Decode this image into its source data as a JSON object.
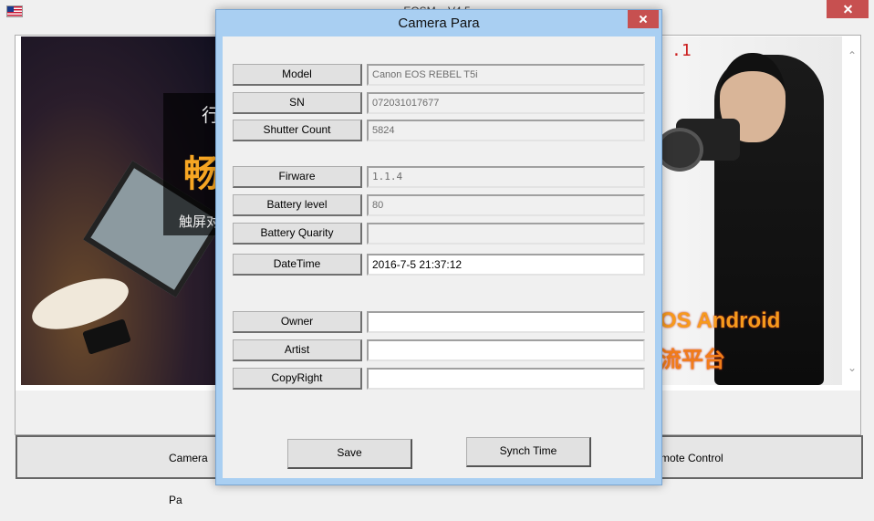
{
  "main": {
    "title": "EOSM... V4.5",
    "banner": {
      "overlay_hang": "行",
      "overlay_chang": "畅",
      "overlay_touch": "触屏对",
      "overlay_version": ".1",
      "overlay_android": "OS Android",
      "overlay_platform": "流平台"
    },
    "buttons": {
      "camera_para": "Camera Pa",
      "remote_control": "mote Control"
    }
  },
  "dialog": {
    "title": "Camera Para",
    "rows": [
      {
        "label": "Model",
        "value": "Canon EOS REBEL T5i",
        "editable": false
      },
      {
        "label": "SN",
        "value": "072031017677",
        "editable": false
      },
      {
        "label": "Shutter Count",
        "value": "5824",
        "editable": false
      },
      {
        "label": "Firware",
        "value": "1.1.4",
        "editable": false
      },
      {
        "label": "Battery level",
        "value": "80",
        "editable": false
      },
      {
        "label": "Battery Quarity",
        "value": "",
        "editable": false
      },
      {
        "label": "DateTime",
        "value": "2016-7-5 21:37:12",
        "editable": true
      },
      {
        "label": "Owner",
        "value": "",
        "editable": true
      },
      {
        "label": "Artist",
        "value": "",
        "editable": true
      },
      {
        "label": "CopyRight",
        "value": "",
        "editable": true
      }
    ],
    "save_label": "Save",
    "synch_label": "Synch Time"
  },
  "icons": {
    "flag": "us-flag-icon",
    "close": "close-icon"
  },
  "colors": {
    "dialog_frame": "#a9cff2",
    "close_button": "#c75050",
    "overlay_orange": "#f79a1c",
    "version_red": "#cc1f1f"
  }
}
